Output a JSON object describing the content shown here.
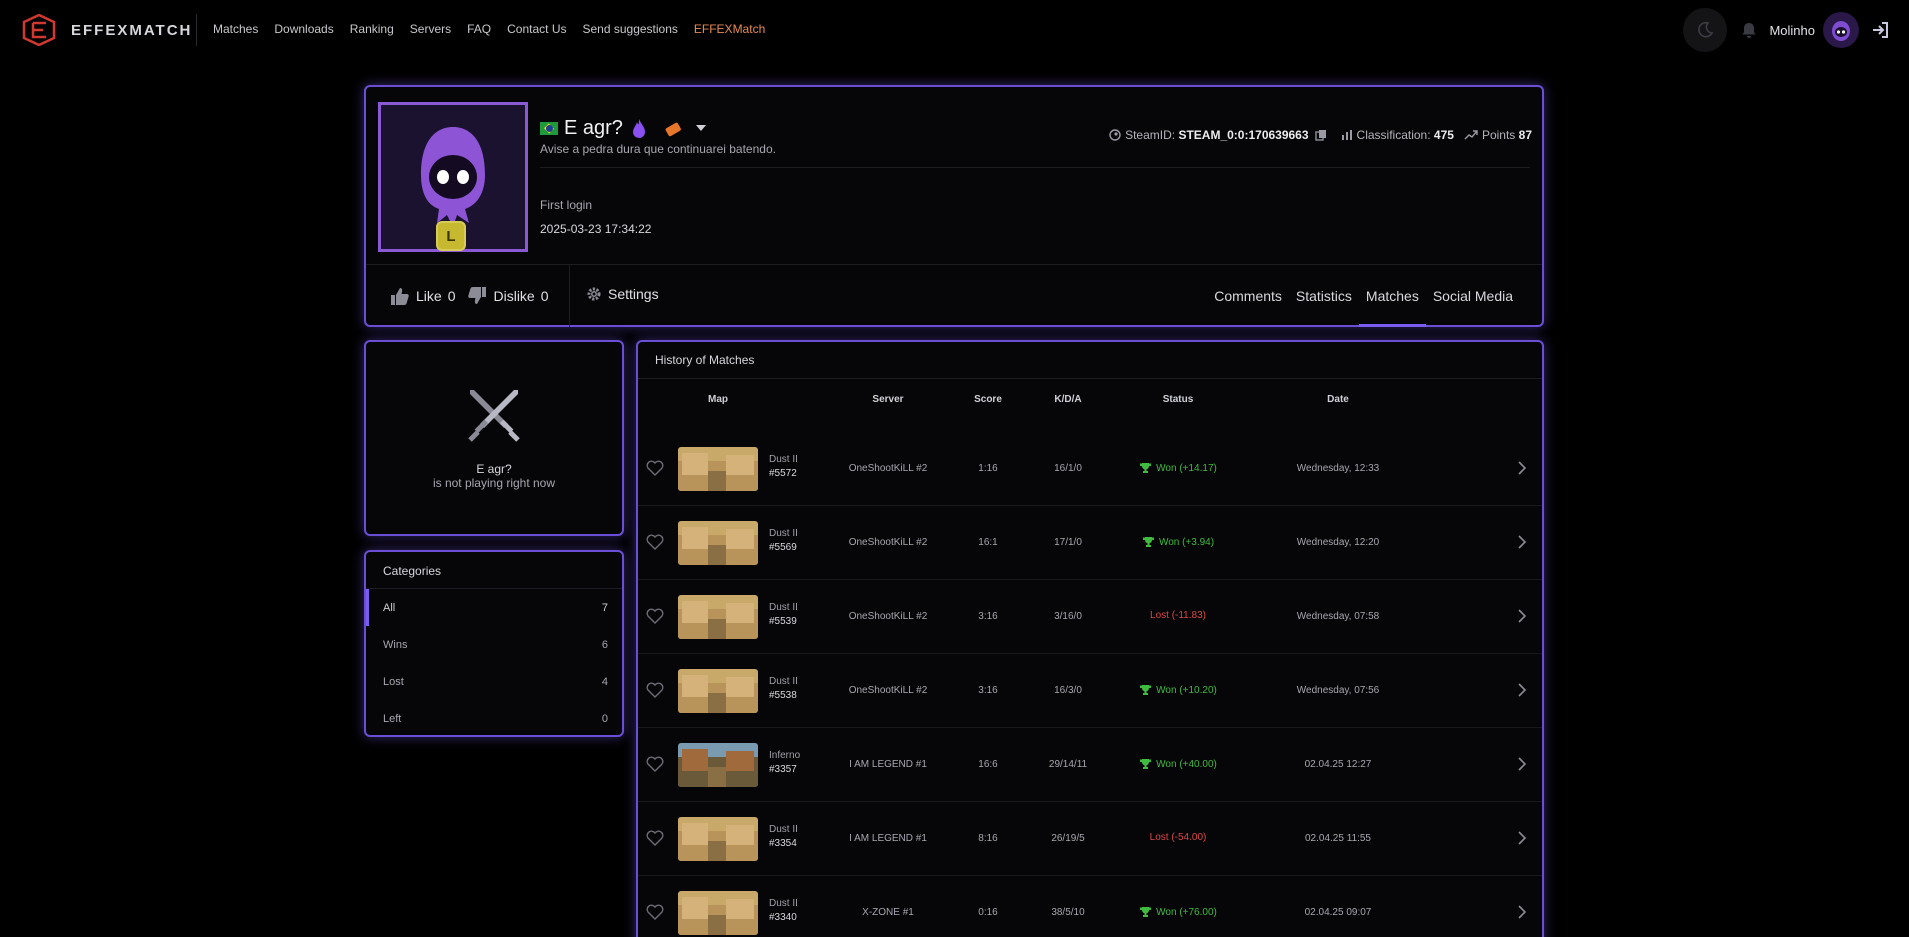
{
  "nav": {
    "brand": "EFFEXMATCH",
    "links": [
      "Matches",
      "Downloads",
      "Ranking",
      "Servers",
      "FAQ",
      "Contact Us",
      "Send suggestions",
      "EFFEXMatch"
    ],
    "username": "Molinho",
    "accent_active": "#e88a53"
  },
  "profile": {
    "name": "E agr?",
    "bio": "Avise a pedra dura que continuarei batendo.",
    "level": "L",
    "first_login_label": "First login",
    "first_login_value": "2025-03-23 17:34:22",
    "steamid_label": "SteamID:",
    "steamid_value": "STEAM_0:0:170639663",
    "classification_label": "Classification:",
    "classification_value": "475",
    "points_label": "Points",
    "points_value": "87",
    "like_label": "Like",
    "like_count": "0",
    "dislike_label": "Dislike",
    "dislike_count": "0",
    "settings_label": "Settings",
    "tabs": [
      "Comments",
      "Statistics",
      "Matches",
      "Social Media"
    ],
    "active_tab": "Matches"
  },
  "status": {
    "name": "E agr?",
    "text": "is not playing right now"
  },
  "categories": {
    "title": "Categories",
    "items": [
      {
        "label": "All",
        "count": "7"
      },
      {
        "label": "Wins",
        "count": "6"
      },
      {
        "label": "Lost",
        "count": "4"
      },
      {
        "label": "Left",
        "count": "0"
      }
    ]
  },
  "matches": {
    "title": "History of Matches",
    "headers": {
      "map": "Map",
      "server": "Server",
      "score": "Score",
      "kda": "K/D/A",
      "status": "Status",
      "date": "Date"
    },
    "rows": [
      {
        "map": "Dust II",
        "id": "#5572",
        "server": "OneShootKiLL #2",
        "score": "1:16",
        "kda": "16/1/0",
        "result": "won",
        "status": "Won (+14.17)",
        "date": "Wednesday, 12:33"
      },
      {
        "map": "Dust II",
        "id": "#5569",
        "server": "OneShootKiLL #2",
        "score": "16:1",
        "kda": "17/1/0",
        "result": "won",
        "status": "Won (+3.94)",
        "date": "Wednesday, 12:20"
      },
      {
        "map": "Dust II",
        "id": "#5539",
        "server": "OneShootKiLL #2",
        "score": "3:16",
        "kda": "3/16/0",
        "result": "lost",
        "status": "Lost (-11.83)",
        "date": "Wednesday, 07:58"
      },
      {
        "map": "Dust II",
        "id": "#5538",
        "server": "OneShootKiLL #2",
        "score": "3:16",
        "kda": "16/3/0",
        "result": "won",
        "status": "Won (+10.20)",
        "date": "Wednesday, 07:56"
      },
      {
        "map": "Inferno",
        "id": "#3357",
        "server": "I AM LEGEND #1",
        "score": "16:6",
        "kda": "29/14/11",
        "result": "won",
        "status": "Won (+40.00)",
        "date": "02.04.25 12:27"
      },
      {
        "map": "Dust II",
        "id": "#3354",
        "server": "I AM LEGEND #1",
        "score": "8:16",
        "kda": "26/19/5",
        "result": "lost",
        "status": "Lost (-54.00)",
        "date": "02.04.25 11:55"
      },
      {
        "map": "Dust II",
        "id": "#3340",
        "server": "X-ZONE #1",
        "score": "0:16",
        "kda": "38/5/10",
        "result": "won",
        "status": "Won (+76.00)",
        "date": "02.04.25 09:07"
      }
    ]
  },
  "colors": {
    "accent": "#7a5cf0",
    "won": "#3fbb3f",
    "lost": "#d94848",
    "brand_red": "#d2392e"
  }
}
